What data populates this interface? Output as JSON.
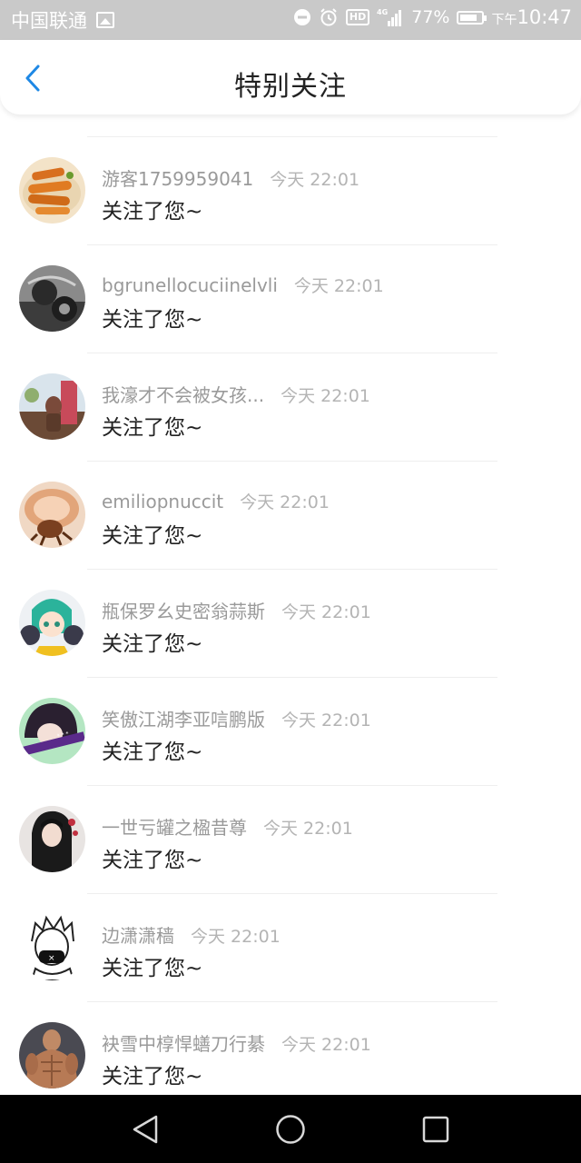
{
  "status_bar": {
    "carrier": "中国联通",
    "network": "4G",
    "battery_percent": "77%",
    "time_prefix": "下午",
    "time": "10:47"
  },
  "header": {
    "title": "特别关注"
  },
  "items": [
    {
      "username": "游客1759959041",
      "time": "今天 22:01",
      "message": "关注了您~"
    },
    {
      "username": "bgrunellocuciinelvli",
      "time": "今天 22:01",
      "message": "关注了您~"
    },
    {
      "username": "我濠才不会被女孩...",
      "time": "今天 22:01",
      "message": "关注了您~"
    },
    {
      "username": "emiliopnuccit",
      "time": "今天 22:01",
      "message": "关注了您~"
    },
    {
      "username": "瓶保罗幺史密翁蒜斯",
      "time": "今天 22:01",
      "message": "关注了您~"
    },
    {
      "username": "笑傲江湖李亚唁鹏版",
      "time": "今天 22:01",
      "message": "关注了您~"
    },
    {
      "username": "一世亏罐之楹昔尊",
      "time": "今天 22:01",
      "message": "关注了您~"
    },
    {
      "username": "边潇潇穑",
      "time": "今天 22:01",
      "message": "关注了您~"
    },
    {
      "username": "袂雪中椁悍蟮刀行綦",
      "time": "今天 22:01",
      "message": "关注了您~"
    }
  ],
  "colors": {
    "accent": "#1e88e5",
    "status_bar": "#c9c9c9",
    "username": "#9a9a9a",
    "timestamp": "#b4b4b4",
    "message": "#222222"
  }
}
